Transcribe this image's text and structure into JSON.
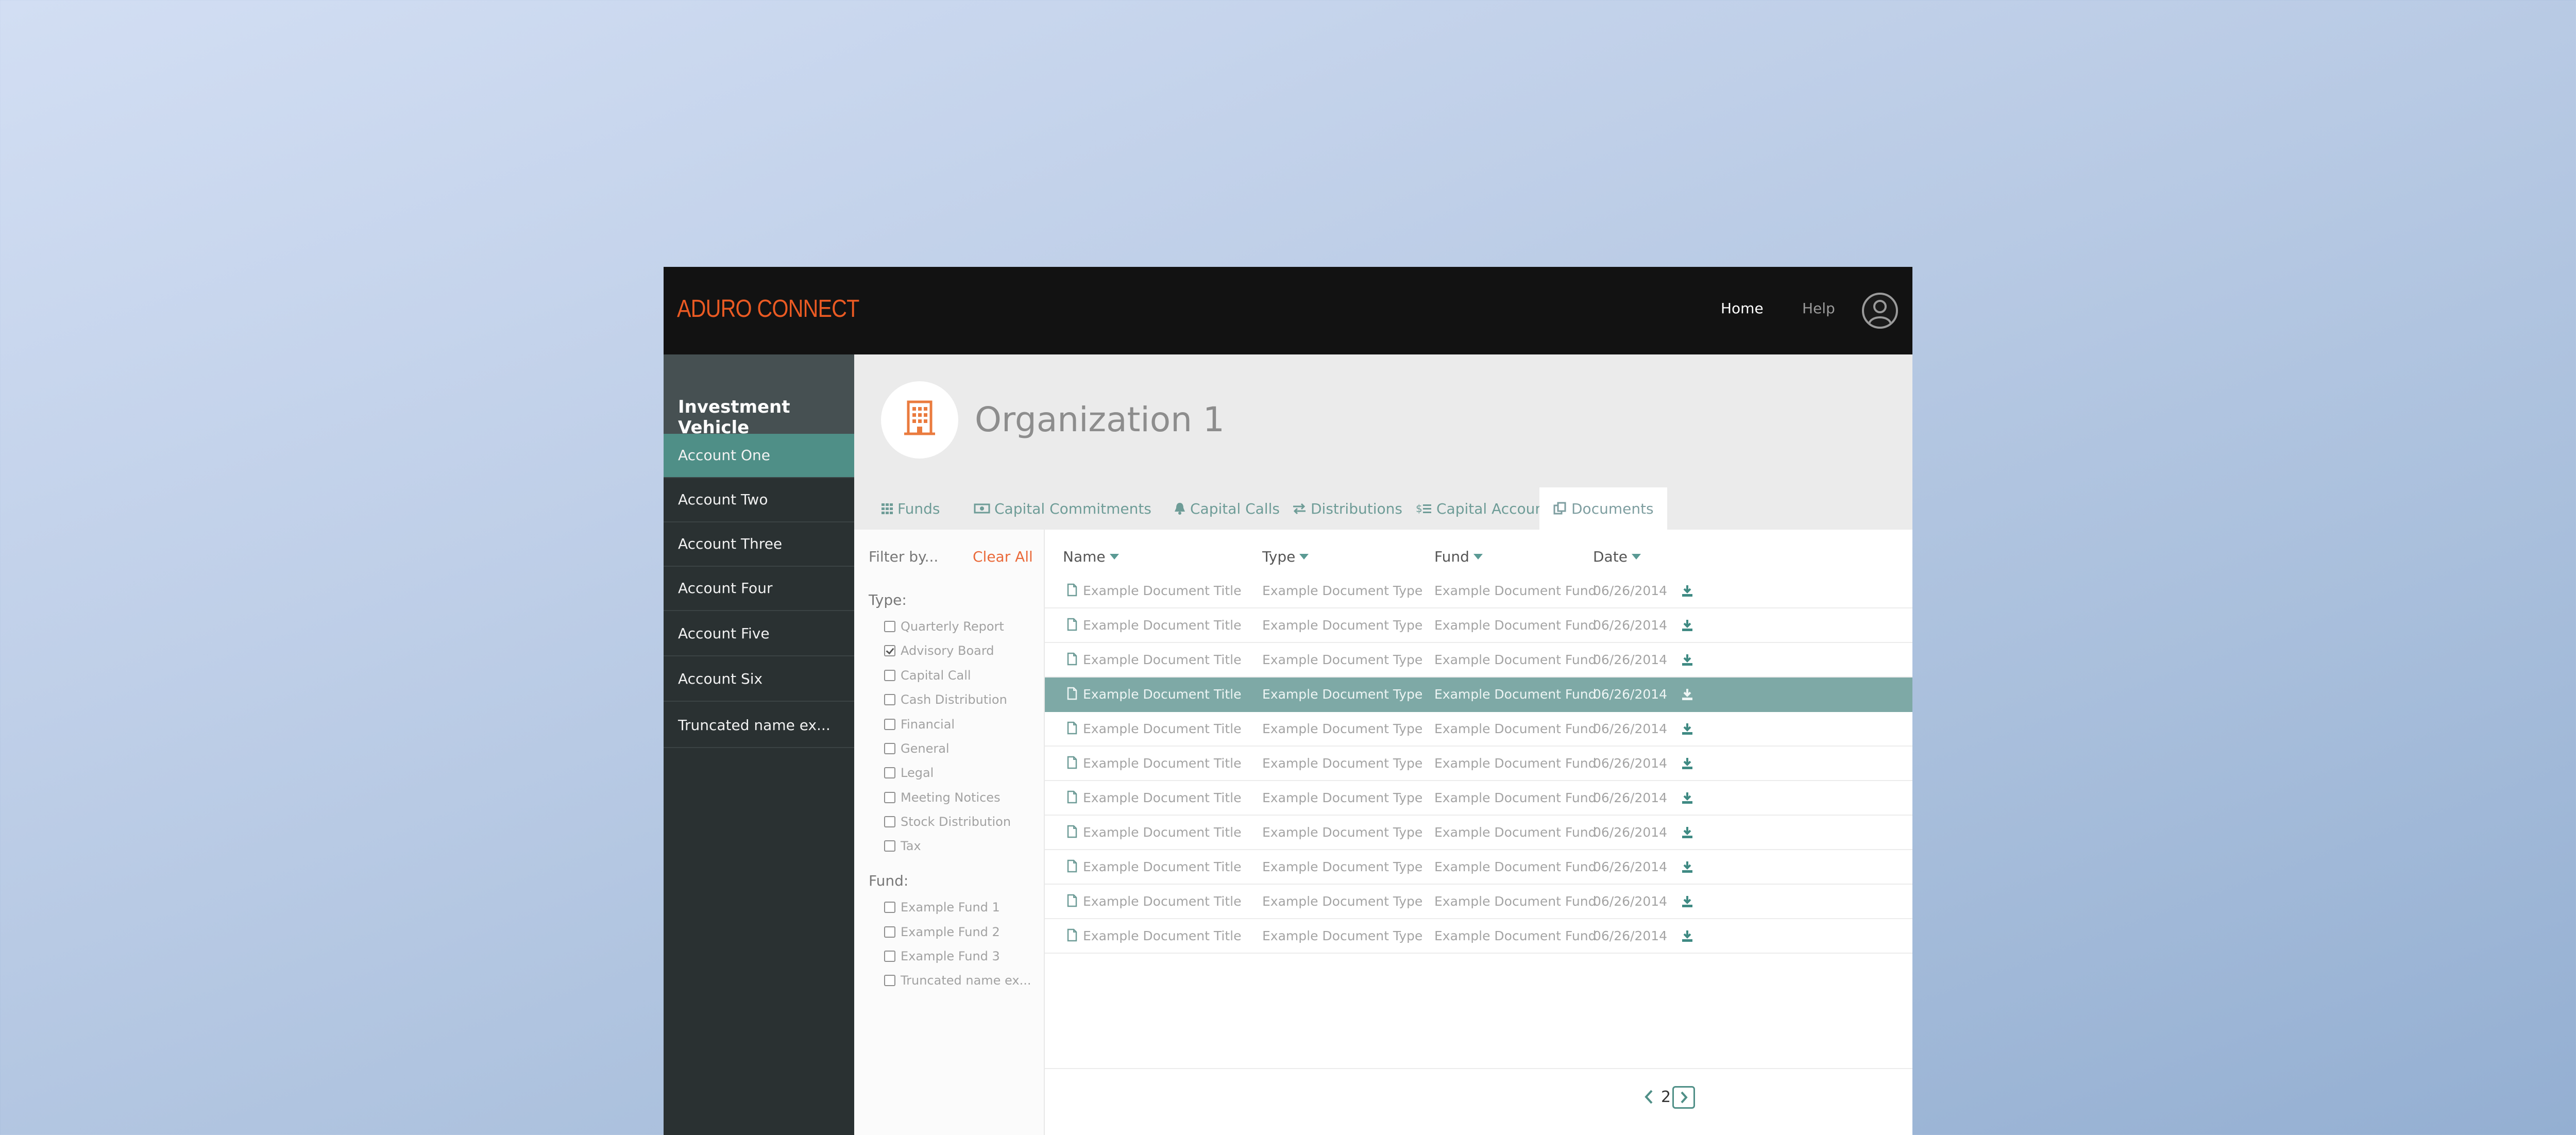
{
  "app": {
    "brand": "ADURO CONNECT"
  },
  "topnav": {
    "home": "Home",
    "help": "Help"
  },
  "sidebar": {
    "title": "Investment Vehicle",
    "items": [
      {
        "label": "Account One",
        "active": true
      },
      {
        "label": "Account Two"
      },
      {
        "label": "Account Three"
      },
      {
        "label": "Account Four"
      },
      {
        "label": "Account Five"
      },
      {
        "label": "Account Six"
      },
      {
        "label": "Truncated name ex..."
      }
    ]
  },
  "org": {
    "name": "Organization 1",
    "icon": "building-icon"
  },
  "tabs": [
    {
      "label": "Funds",
      "icon": "grid-icon"
    },
    {
      "label": "Capital Commitments",
      "icon": "money-icon"
    },
    {
      "label": "Capital Calls",
      "icon": "bell-icon"
    },
    {
      "label": "Distributions",
      "icon": "exchange-icon"
    },
    {
      "label": "Capital Accounts",
      "icon": "dollar-list-icon"
    },
    {
      "label": "Documents",
      "icon": "documents-icon",
      "active": true
    }
  ],
  "filters": {
    "filter_by": "Filter by...",
    "clear_all": "Clear All",
    "type_heading": "Type:",
    "type_options": [
      {
        "label": "Quarterly Report",
        "checked": false
      },
      {
        "label": "Advisory Board",
        "checked": true
      },
      {
        "label": "Capital Call",
        "checked": false
      },
      {
        "label": "Cash Distribution",
        "checked": false
      },
      {
        "label": "Financial",
        "checked": false
      },
      {
        "label": "General",
        "checked": false
      },
      {
        "label": "Legal",
        "checked": false
      },
      {
        "label": "Meeting Notices",
        "checked": false
      },
      {
        "label": "Stock Distribution",
        "checked": false
      },
      {
        "label": "Tax",
        "checked": false
      }
    ],
    "fund_heading": "Fund:",
    "fund_options": [
      {
        "label": "Example Fund 1",
        "checked": false
      },
      {
        "label": "Example Fund 2",
        "checked": false
      },
      {
        "label": "Example Fund 3",
        "checked": false
      },
      {
        "label": "Truncated name ex...",
        "checked": false
      }
    ]
  },
  "table": {
    "columns": [
      "Name",
      "Type",
      "Fund",
      "Date"
    ],
    "rows": [
      {
        "name": "Example Document Title",
        "type": "Example Document Type",
        "fund": "Example Document Fund",
        "date": "06/26/2014"
      },
      {
        "name": "Example Document Title",
        "type": "Example Document Type",
        "fund": "Example Document Fund",
        "date": "06/26/2014"
      },
      {
        "name": "Example Document Title",
        "type": "Example Document Type",
        "fund": "Example Document Fund",
        "date": "06/26/2014"
      },
      {
        "name": "Example Document Title",
        "type": "Example Document Type",
        "fund": "Example Document Fund",
        "date": "06/26/2014",
        "selected": true
      },
      {
        "name": "Example Document Title",
        "type": "Example Document Type",
        "fund": "Example Document Fund",
        "date": "06/26/2014"
      },
      {
        "name": "Example Document Title",
        "type": "Example Document Type",
        "fund": "Example Document Fund",
        "date": "06/26/2014"
      },
      {
        "name": "Example Document Title",
        "type": "Example Document Type",
        "fund": "Example Document Fund",
        "date": "06/26/2014"
      },
      {
        "name": "Example Document Title",
        "type": "Example Document Type",
        "fund": "Example Document Fund",
        "date": "06/26/2014"
      },
      {
        "name": "Example Document Title",
        "type": "Example Document Type",
        "fund": "Example Document Fund",
        "date": "06/26/2014"
      },
      {
        "name": "Example Document Title",
        "type": "Example Document Type",
        "fund": "Example Document Fund",
        "date": "06/26/2014"
      },
      {
        "name": "Example Document Title",
        "type": "Example Document Type",
        "fund": "Example Document Fund",
        "date": "06/26/2014"
      }
    ]
  },
  "pagination": {
    "page": "2"
  },
  "colors": {
    "brand": "#ea5a23",
    "accent": "#4f8f87",
    "selected_row": "#7ea9a6",
    "topbar": "#121212",
    "sidebar": "#2a3132"
  }
}
